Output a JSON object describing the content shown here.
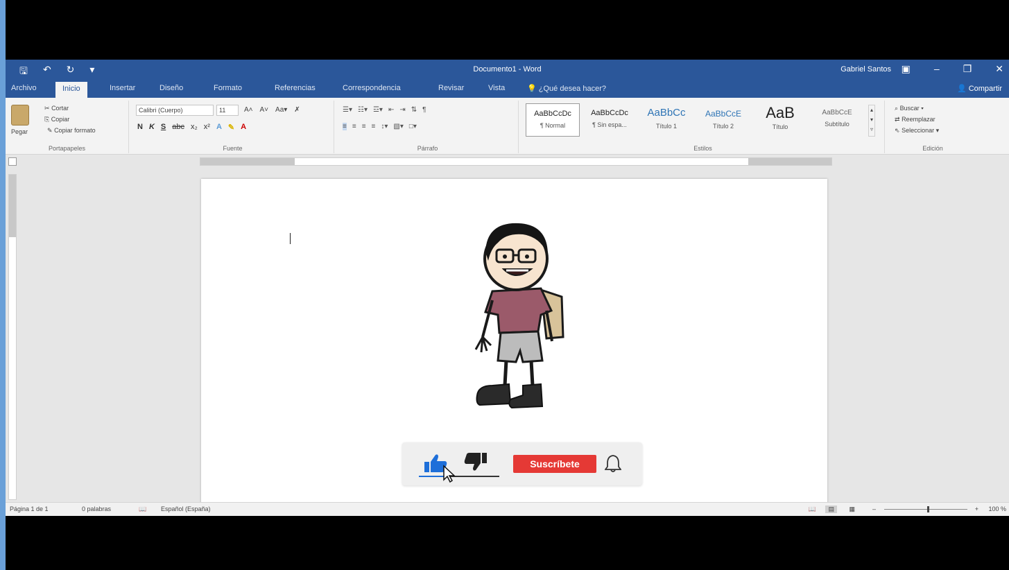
{
  "colors": {
    "word_blue": "#2b579a",
    "subscribe_red": "#e53935",
    "like_blue": "#1e6fd9"
  },
  "titlebar": {
    "title": "Documento1 - Word",
    "user": "Gabriel Santos",
    "qat_icons": [
      "save-icon",
      "undo-icon",
      "redo-icon",
      "customize-icon"
    ]
  },
  "tabs": {
    "items": [
      "Archivo",
      "Inicio",
      "Insertar",
      "Diseño",
      "Formato",
      "Referencias",
      "Correspondencia",
      "Revisar",
      "Vista"
    ],
    "active": "Inicio",
    "tell_me": "¿Qué desea hacer?",
    "share": "Compartir"
  },
  "ribbon": {
    "clipboard": {
      "paste": "Pegar",
      "cut": "Cortar",
      "copy": "Copiar",
      "format_painter": "Copiar formato",
      "label": "Portapapeles"
    },
    "font": {
      "font_name": "Calibri (Cuerpo)",
      "font_size": "11",
      "label": "Fuente"
    },
    "paragraph": {
      "label": "Párrafo"
    },
    "styles": {
      "label": "Estilos",
      "items": [
        {
          "sample": "AaBbCcDc",
          "name": "¶ Normal"
        },
        {
          "sample": "AaBbCcDc",
          "name": "¶ Sin espa..."
        },
        {
          "sample": "AaBbCc",
          "name": "Título 1"
        },
        {
          "sample": "AaBbCcE",
          "name": "Título 2"
        },
        {
          "sample": "AaB",
          "name": "Título"
        },
        {
          "sample": "AaBbCcE",
          "name": "Subtítulo"
        }
      ]
    },
    "editing": {
      "find": "Buscar",
      "replace": "Reemplazar",
      "select": "Seleccionar",
      "label": "Edición"
    }
  },
  "overlay": {
    "subscribe": "Suscríbete",
    "icons": [
      "like-icon",
      "dislike-icon",
      "bell-icon",
      "pointer-icon"
    ]
  },
  "statusbar": {
    "page": "Página 1 de 1",
    "words": "0 palabras",
    "language": "Español (España)",
    "zoom": "100 %"
  }
}
